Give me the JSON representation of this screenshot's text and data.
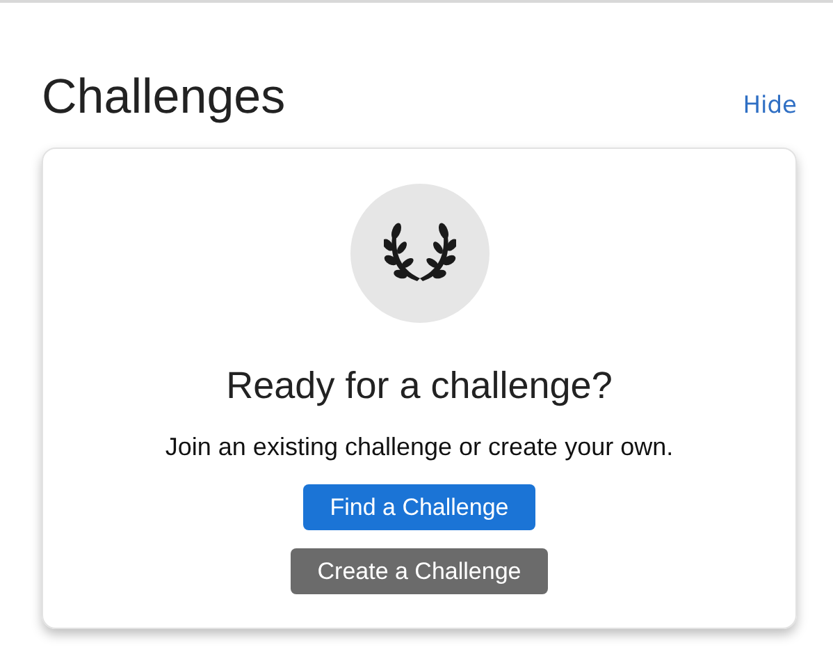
{
  "header": {
    "title": "Challenges",
    "action": "Hide"
  },
  "card": {
    "heading": "Ready for a challenge?",
    "description": "Join an existing challenge or create your own.",
    "buttons": [
      {
        "label": "Find a Challenge",
        "kind": "primary"
      },
      {
        "label": "Create a Challenge",
        "kind": "secondary"
      }
    ]
  }
}
